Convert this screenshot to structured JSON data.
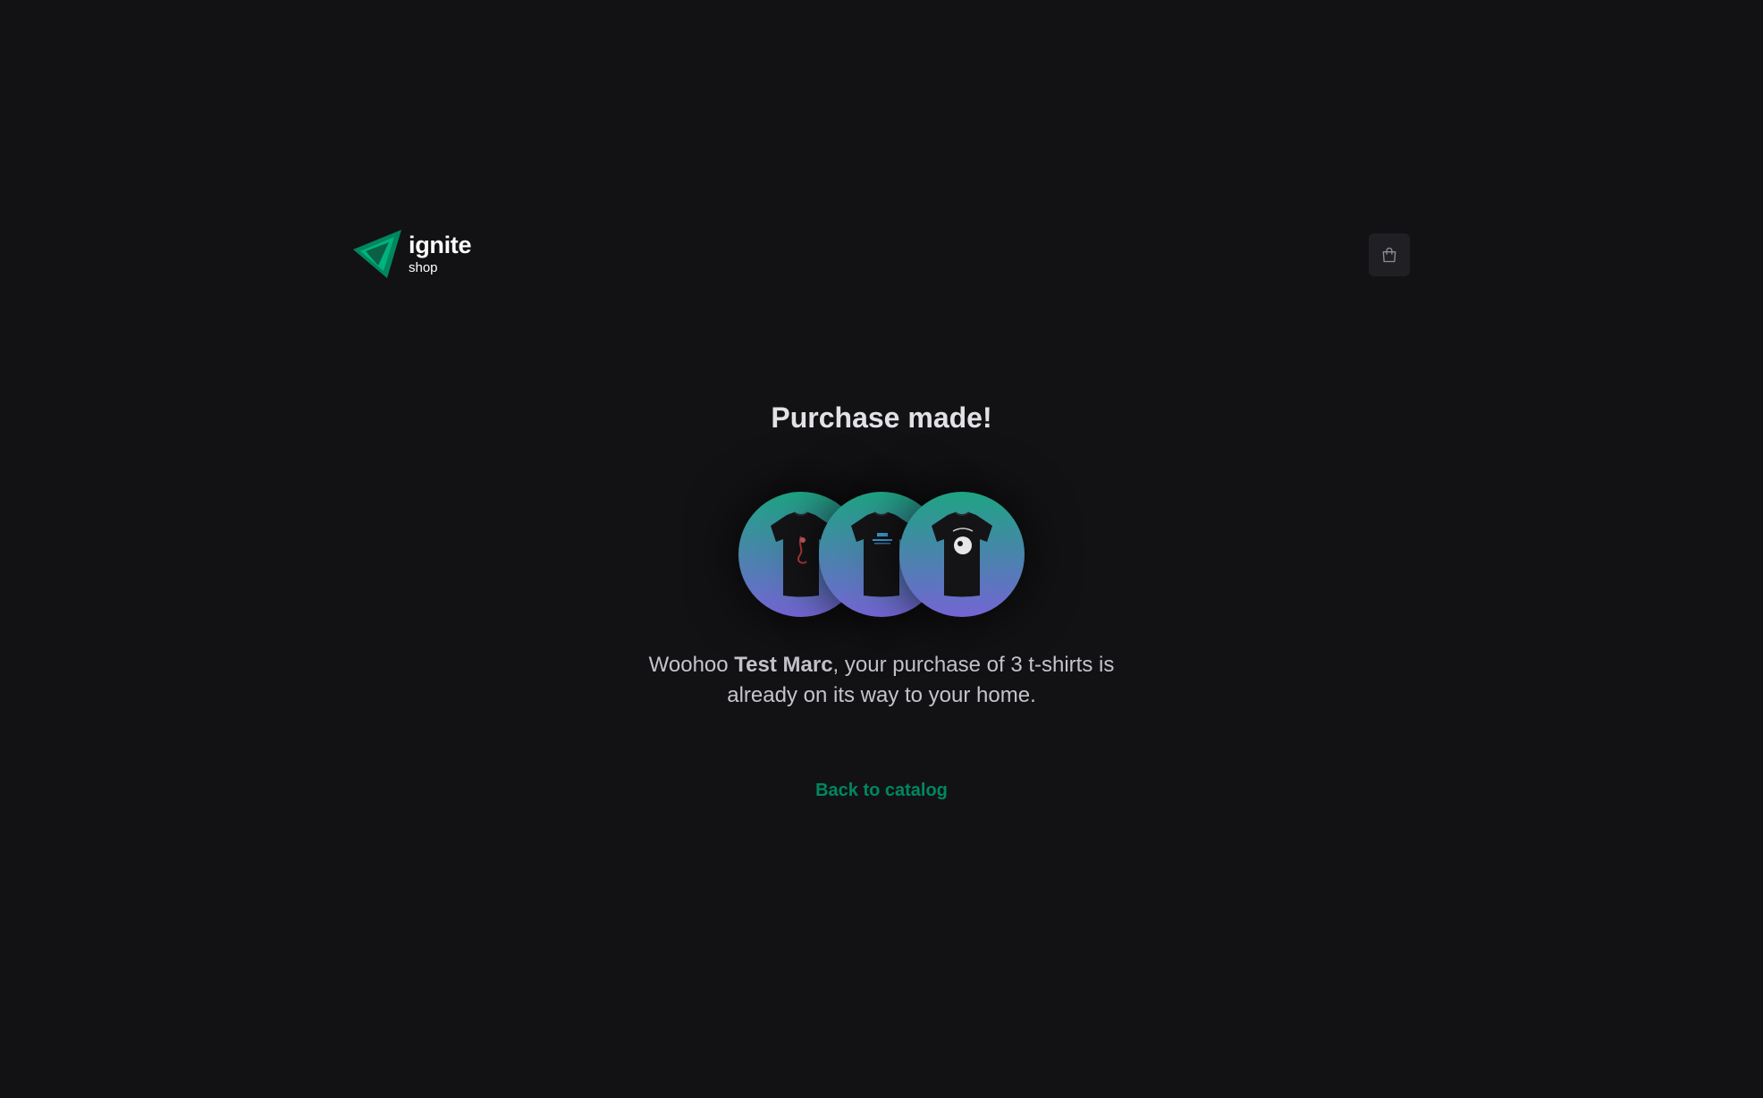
{
  "brand": {
    "name": "ignite",
    "sub": "shop",
    "accent": "#00875f"
  },
  "header": {
    "cart_icon": "shopping-bag-icon"
  },
  "success": {
    "title": "Purchase made!",
    "products": [
      {
        "icon": "tshirt-image",
        "print": "red-figure"
      },
      {
        "icon": "tshirt-image",
        "print": "blue-logo"
      },
      {
        "icon": "tshirt-image",
        "print": "white-emblem"
      }
    ],
    "message_prefix": "Woohoo ",
    "customer_name": "Test Marc",
    "message_suffix": ", your purchase of 3 t-shirts is already on its way to your home.",
    "back_label": "Back to catalog"
  },
  "colors": {
    "background": "#121214",
    "gradient_start": "#1ea483",
    "gradient_end": "#7465d4",
    "link": "#00875f"
  }
}
